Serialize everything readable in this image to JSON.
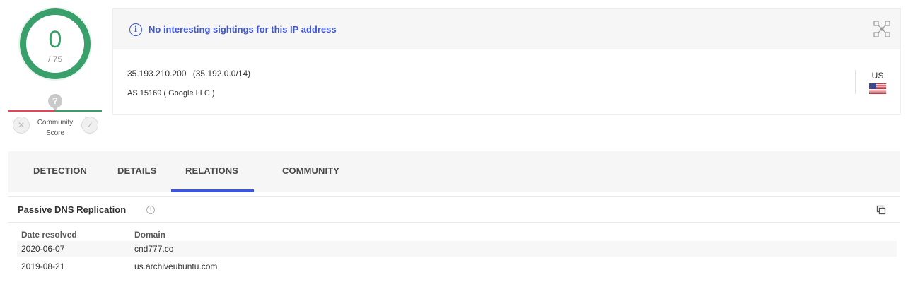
{
  "score": {
    "detections": "0",
    "total": "/ 75",
    "community_label_line1": "Community",
    "community_label_line2": "Score",
    "community_unknown": "?",
    "community_down": "✕",
    "community_up": "✓"
  },
  "header": {
    "sightings_text": "No interesting sightings for this IP address",
    "info_glyph": "i",
    "ip_address": "35.193.210.200",
    "ip_range": "(35.192.0.0/14)",
    "as_line": "AS 15169 ( Google LLC )",
    "country_code": "US",
    "icons": [
      "info-icon",
      "qr-code-icon",
      "us-flag-icon"
    ]
  },
  "tabs": [
    {
      "label": "DETECTION",
      "active": false
    },
    {
      "label": "DETAILS",
      "active": false
    },
    {
      "label": "RELATIONS",
      "active": true
    },
    {
      "label": "COMMUNITY",
      "active": false
    }
  ],
  "passive_dns": {
    "title": "Passive DNS Replication",
    "info_glyph": "i",
    "columns": [
      "Date resolved",
      "Domain"
    ],
    "rows": [
      {
        "date": "2020-06-07",
        "domain": "cnd777.co"
      },
      {
        "date": "2019-08-21",
        "domain": "us.archiveubuntu.com"
      }
    ]
  },
  "colors": {
    "accent": "#3e57d8",
    "clean_green": "#3aa06b",
    "malicious_red": "#e5455b"
  }
}
